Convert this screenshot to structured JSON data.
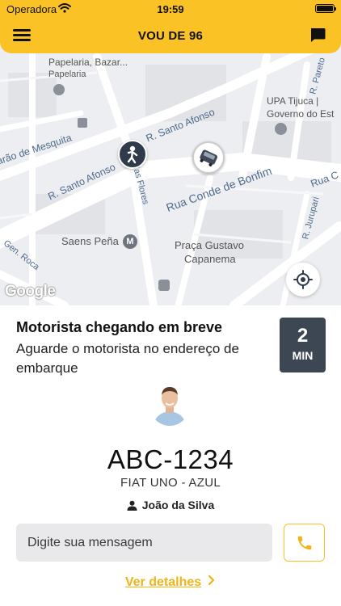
{
  "statusbar": {
    "carrier": "Operadora",
    "time": "19:59"
  },
  "header": {
    "title": "VOU DE 96"
  },
  "map": {
    "labels": {
      "papelaria_bazar": "Papelaria, Bazar...",
      "papelaria": "Papelaria",
      "upa": "UPA Tijuca |",
      "governo": "Governo do Est",
      "r_pareto": "R. Pareto",
      "mesquita": "arão de Mesquita",
      "santo_afonso_1": "R. Santo Afonso",
      "santo_afonso_2": "R. Santo Afonso",
      "das_flores": "das Flores",
      "conde_bonfim": "Rua Conde de Bonfim",
      "rua_c": "Rua C",
      "saens_pena": "Saens Peña",
      "gen_roca": "Gen. Roca",
      "praca_1": "Praça Gustavo",
      "praca_2": "Capanema",
      "jurupari": "R. Jurupari",
      "google": "Google"
    }
  },
  "ride": {
    "status_title": "Motorista chegando em breve",
    "status_desc": "Aguarde o motorista no endereço de embarque",
    "eta_value": "2",
    "eta_unit": "MIN",
    "plate": "ABC-1234",
    "car_model": "FIAT UNO - AZUL",
    "driver_name": "João da Silva"
  },
  "message": {
    "placeholder": "Digite sua mensagem"
  },
  "links": {
    "details": "Ver detalhes"
  },
  "colors": {
    "brand_yellow": "#FBC226",
    "eta_bg": "#3D4754",
    "link_color": "#F2B414"
  },
  "icons": {
    "menu": "hamburger-menu-icon",
    "chat": "chat-bubble-icon",
    "locate": "locate-icon",
    "phone": "phone-icon",
    "user": "user-icon",
    "chevron": "chevron-right-icon"
  }
}
